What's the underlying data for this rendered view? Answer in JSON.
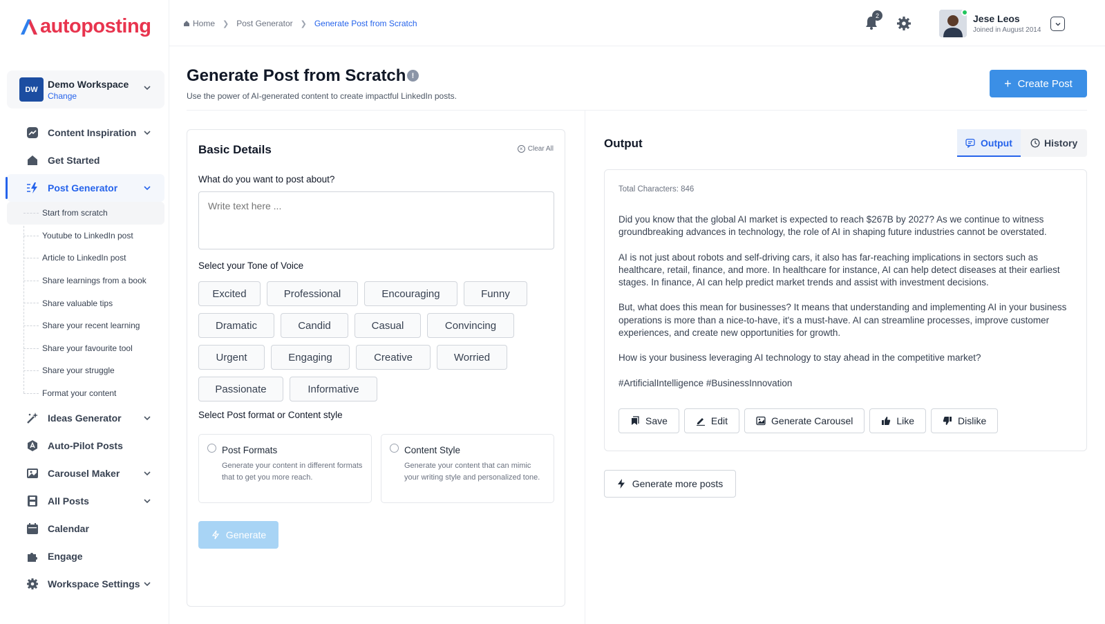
{
  "brand": {
    "name": "autoposting",
    "color": "#e8344e"
  },
  "workspace": {
    "initials": "DW",
    "name": "Demo Workspace",
    "change_label": "Change"
  },
  "nav": {
    "items": [
      {
        "label": "Content Inspiration",
        "icon": "chart-icon",
        "has_chevron": true
      },
      {
        "label": "Get Started",
        "icon": "home-icon",
        "has_chevron": false
      },
      {
        "label": "Post Generator",
        "icon": "lightning-icon",
        "has_chevron": true,
        "active": true
      },
      {
        "label": "Ideas Generator",
        "icon": "magic-wand-icon",
        "has_chevron": true
      },
      {
        "label": "Auto-Pilot Posts",
        "icon": "autopilot-icon",
        "has_chevron": false
      },
      {
        "label": "Carousel Maker",
        "icon": "image-icon",
        "has_chevron": true
      },
      {
        "label": "All Posts",
        "icon": "save-icon",
        "has_chevron": true
      },
      {
        "label": "Calendar",
        "icon": "calendar-icon",
        "has_chevron": false
      },
      {
        "label": "Engage",
        "icon": "puzzle-icon",
        "has_chevron": false
      },
      {
        "label": "Workspace Settings",
        "icon": "gear-icon",
        "has_chevron": true
      }
    ],
    "post_generator_sub": [
      "Start from scratch",
      "Youtube to LinkedIn post",
      "Article to LinkedIn post",
      "Share learnings from a book",
      "Share valuable tips",
      "Share your recent learning",
      "Share your favourite tool",
      "Share your struggle",
      "Format your content"
    ]
  },
  "breadcrumb": {
    "home": "Home",
    "parent": "Post Generator",
    "current": "Generate Post from Scratch"
  },
  "topbar": {
    "notification_count": "2",
    "user_name": "Jese Leos",
    "user_joined": "Joined in August 2014"
  },
  "page": {
    "title": "Generate Post from Scratch",
    "info_glyph": "!",
    "subtitle": "Use the power of AI-generated content to create impactful LinkedIn posts.",
    "create_button": "Create Post"
  },
  "basic": {
    "title": "Basic Details",
    "clear_all": "Clear All",
    "topic_label": "What do you want to post about?",
    "topic_placeholder": "Write text here ...",
    "tone_label": "Select your Tone of Voice",
    "tones": [
      [
        "Excited",
        "Professional",
        "Encouraging",
        "Funny"
      ],
      [
        "Dramatic",
        "Candid",
        "Casual",
        "Convincing"
      ],
      [
        "Urgent",
        "Engaging",
        "Creative",
        "Worried"
      ],
      [
        "Passionate",
        "Informative"
      ]
    ],
    "format_label": "Select Post format or Content style",
    "formats": [
      {
        "title": "Post Formats",
        "desc": "Generate your content in different formats that to get you more reach."
      },
      {
        "title": "Content Style",
        "desc": "Generate your content that can mimic your writing style and personalized tone."
      }
    ],
    "generate_button": "Generate"
  },
  "output": {
    "title": "Output",
    "tabs": {
      "output": "Output",
      "history": "History"
    },
    "char_count": "Total Characters: 846",
    "paragraphs": [
      "Did you know that the global AI market is expected to reach $267B by 2027? As we continue to witness groundbreaking advances in technology, the role of AI in shaping future industries cannot be overstated.",
      "AI is not just about robots and self-driving cars, it also has far-reaching implications in sectors such as healthcare, retail, finance, and more. In healthcare for instance, AI can help detect diseases at their earliest stages. In finance, AI can help predict market trends and assist with investment decisions.",
      "But, what does this mean for businesses? It means that understanding and implementing AI in your business operations is more than a nice-to-have, it's a must-have. AI can streamline processes, improve customer experiences, and create new opportunities for growth.",
      "How is your business leveraging AI technology to stay ahead in the competitive market?",
      "#ArtificialIntelligence #BusinessInnovation"
    ],
    "actions": {
      "save": "Save",
      "edit": "Edit",
      "carousel": "Generate Carousel",
      "like": "Like",
      "dislike": "Dislike"
    },
    "more_button": "Generate more posts"
  },
  "colors": {
    "accent": "#2563eb",
    "primary_button": "#3b8fe6",
    "disabled_button": "#a8d4f5"
  }
}
